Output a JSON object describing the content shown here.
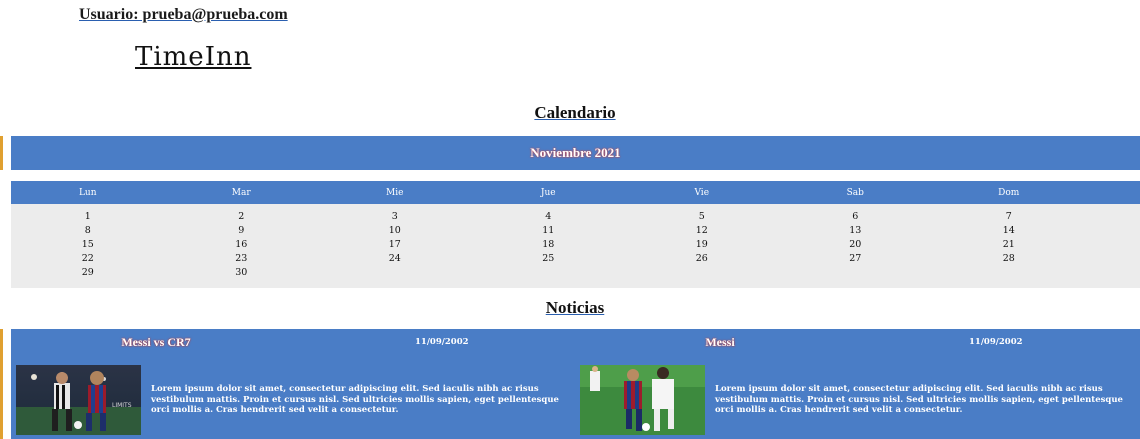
{
  "header": {
    "user_label": "Usuario: prueba@prueba.com",
    "brand": "TimeInn"
  },
  "calendar": {
    "title": "Calendario",
    "month": "Noviembre 2021",
    "weekdays": [
      "Lun",
      "Mar",
      "Mie",
      "Jue",
      "Vie",
      "Sab",
      "Dom"
    ],
    "days_by_weekday": [
      [
        "1",
        "8",
        "15",
        "22",
        "29"
      ],
      [
        "2",
        "9",
        "16",
        "23",
        "30"
      ],
      [
        "3",
        "10",
        "17",
        "24"
      ],
      [
        "4",
        "11",
        "18",
        "25"
      ],
      [
        "5",
        "12",
        "19",
        "26"
      ],
      [
        "6",
        "13",
        "20",
        "27"
      ],
      [
        "7",
        "14",
        "21",
        "28"
      ]
    ]
  },
  "news": {
    "title": "Noticias",
    "items": [
      {
        "title": "Messi vs CR7",
        "date": "11/09/2002",
        "body": "Lorem ipsum dolor sit amet, consectetur adipiscing elit. Sed iaculis nibh ac risus vestibulum mattis. Proin et cursus nisl. Sed ultricies mollis sapien, eget pellentesque orci mollis a. Cras hendrerit sed velit a consectetur."
      },
      {
        "title": "Messi",
        "date": "11/09/2002",
        "body": "Lorem ipsum dolor sit amet, consectetur adipiscing elit. Sed iaculis nibh ac risus vestibulum mattis. Proin et cursus nisl. Sed ultricies mollis sapien, eget pellentesque orci mollis a. Cras hendrerit sed velit a consectetur."
      }
    ]
  },
  "colors": {
    "accent_blue": "#4a7dc6",
    "grid_bg": "#ececec",
    "left_accent": "#e0a030"
  }
}
